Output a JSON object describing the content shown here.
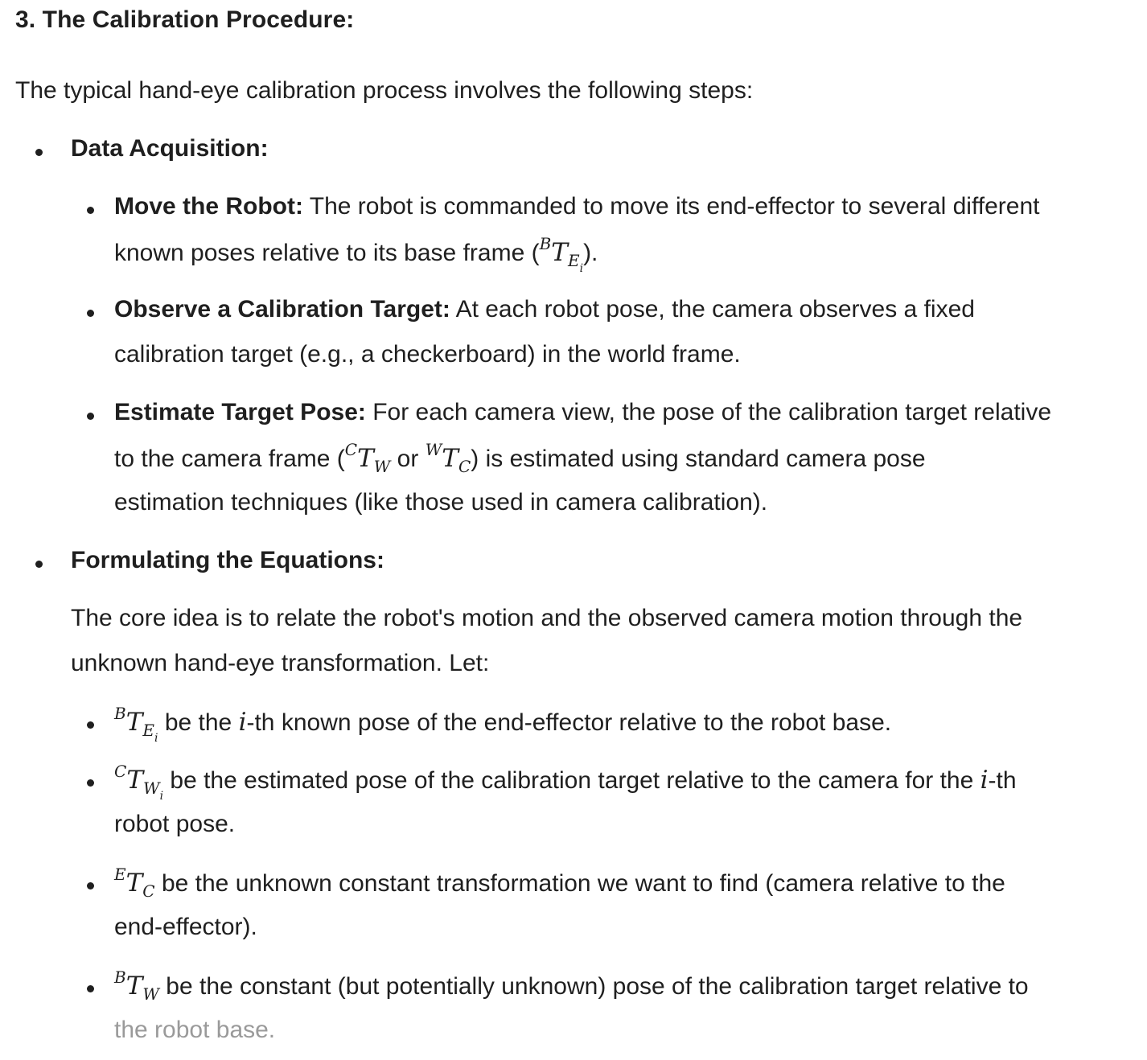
{
  "heading": "3. The Calibration Procedure:",
  "intro": "The typical hand-eye calibration process involves the following steps:",
  "data_acquisition": {
    "label": "Data Acquisition:",
    "items": [
      {
        "label": "Move the Robot:",
        "line1": " The robot is commanded to move its end-effector to several different",
        "line2_pre": "known poses relative to its base frame (",
        "line2_post": ")."
      },
      {
        "label": "Observe a Calibration Target:",
        "line1": " At each robot pose, the camera observes a fixed",
        "line2": "calibration target (e.g., a checkerboard) in the world frame."
      },
      {
        "label": "Estimate Target Pose:",
        "line1": " For each camera view, the pose of the calibration target relative",
        "line2_pre": "to the camera frame (",
        "line2_or": " or ",
        "line2_post": ") is estimated using standard camera pose",
        "line3": "estimation techniques (like those used in camera calibration)."
      }
    ]
  },
  "formulating": {
    "label": "Formulating the Equations:",
    "para_line1": "The core idea is to relate the robot's motion and the observed camera motion through the",
    "para_line2": "unknown hand-eye transformation. Let:",
    "items": [
      {
        "line1_mid": " be the ",
        "line1_post": "-th known pose of the end-effector relative to the robot base."
      },
      {
        "line1_mid": " be the estimated pose of the calibration target relative to the camera for the ",
        "line1_post": "-th",
        "line2": "robot pose."
      },
      {
        "line1_post": " be the unknown constant transformation we want to find (camera relative to the",
        "line2": "end-effector)."
      },
      {
        "line1_post": " be the constant (but potentially unknown) pose of the calibration target relative to",
        "line2": "the robot base."
      }
    ]
  },
  "math": {
    "T": "T",
    "B": "B",
    "C": "C",
    "W": "W",
    "E": "E",
    "i": "i"
  }
}
